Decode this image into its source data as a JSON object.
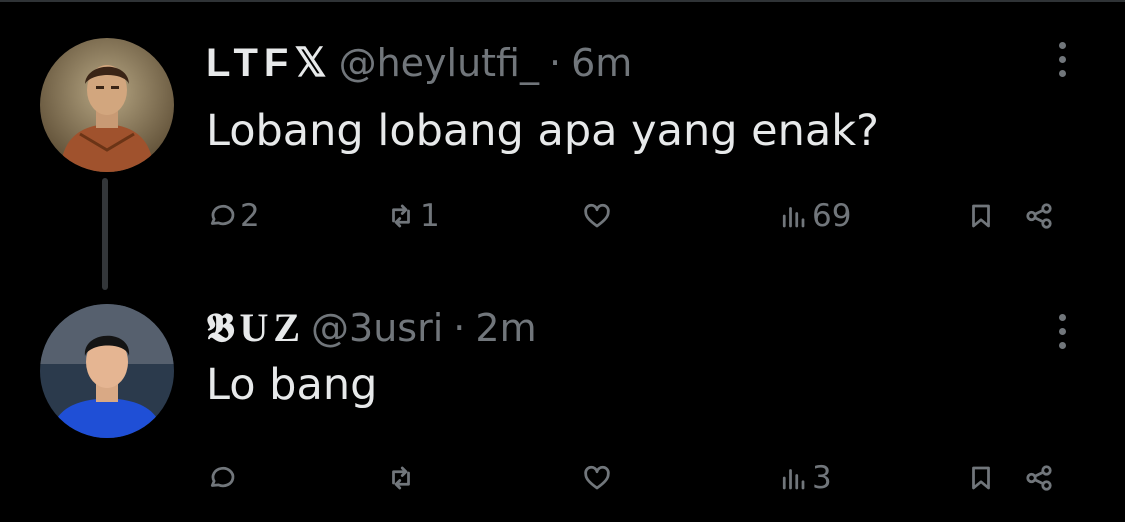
{
  "tweets": [
    {
      "name": "LTF𝕏",
      "handle": "@heylutfi_",
      "separator": "·",
      "time": "6m",
      "text": "Lobang lobang apa yang enak?",
      "replies": "2",
      "retweets": "1",
      "likes": "",
      "views": "69"
    },
    {
      "name": "𝕭UZ",
      "handle": "@3usri",
      "separator": "·",
      "time": "2m",
      "text": "Lo bang",
      "replies": "",
      "retweets": "",
      "likes": "",
      "views": "3"
    }
  ],
  "colors": {
    "background": "#000000",
    "text": "#e7e9ea",
    "muted": "#71767b",
    "thread_line": "#333639"
  }
}
